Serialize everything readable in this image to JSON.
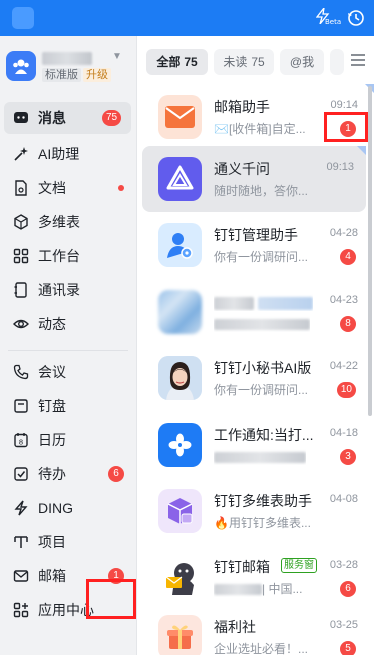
{
  "topbar": {
    "beta_label": "Beta",
    "icons": [
      "app-logo",
      "beta-lightning-icon",
      "history-icon"
    ]
  },
  "sidebar": {
    "profile": {
      "edition": "标准版",
      "upgrade": "升级"
    },
    "items": [
      {
        "label": "消息",
        "icon": "message-icon",
        "badge": "75",
        "active": true
      },
      {
        "label": "AI助理",
        "icon": "ai-sparkle-icon"
      },
      {
        "label": "文档",
        "icon": "document-icon",
        "dot": true
      },
      {
        "label": "多维表",
        "icon": "multidim-table-icon"
      },
      {
        "label": "工作台",
        "icon": "workbench-grid-icon"
      },
      {
        "label": "通讯录",
        "icon": "contacts-icon"
      },
      {
        "label": "动态",
        "icon": "activity-eye-icon"
      },
      {
        "label": "会议",
        "icon": "meeting-phone-icon"
      },
      {
        "label": "钉盘",
        "icon": "disk-icon"
      },
      {
        "label": "日历",
        "icon": "calendar-icon"
      },
      {
        "label": "待办",
        "icon": "todo-check-icon",
        "badge": "6"
      },
      {
        "label": "DING",
        "icon": "ding-lightning-icon"
      },
      {
        "label": "项目",
        "icon": "project-icon"
      },
      {
        "label": "邮箱",
        "icon": "mail-icon",
        "badge": "1"
      },
      {
        "label": "应用中心",
        "icon": "app-center-icon"
      }
    ]
  },
  "tabs": [
    {
      "label": "全部",
      "count": "75",
      "active": true
    },
    {
      "label": "未读",
      "count": "75"
    },
    {
      "label": "@我",
      "count": ""
    }
  ],
  "conversations": [
    {
      "name": "邮箱助手",
      "time": "09:14",
      "preview": "[收件箱]自定...",
      "badge": "1",
      "corner": true
    },
    {
      "name": "通义千问",
      "time": "09:13",
      "preview": "随时随地，答你...",
      "badge": "",
      "corner": true,
      "selected": true
    },
    {
      "name": "钉钉管理助手",
      "time": "04-28",
      "preview": "你有一份调研问...",
      "badge": "4"
    },
    {
      "name": "",
      "time": "04-23",
      "preview": "",
      "badge": "8",
      "blurred": true
    },
    {
      "name": "钉钉小秘书AI版",
      "time": "04-22",
      "preview": "你有一份调研问...",
      "badge": "10"
    },
    {
      "name": "工作通知:当打...",
      "time": "04-18",
      "preview": "",
      "badge": "3"
    },
    {
      "name": "钉钉多维表助手",
      "time": "04-08",
      "preview": "🔥用钉钉多维表...",
      "badge": ""
    },
    {
      "name": "钉钉邮箱",
      "tag": "服务窗",
      "time": "03-28",
      "preview": "| 中国...",
      "badge": "6"
    },
    {
      "name": "福利社",
      "time": "03-25",
      "preview": "企业选址必看！...",
      "badge": "5"
    }
  ],
  "colors": {
    "brand": "#1c7cf4",
    "badge": "#f54a45",
    "highlight": "#ff2020"
  }
}
